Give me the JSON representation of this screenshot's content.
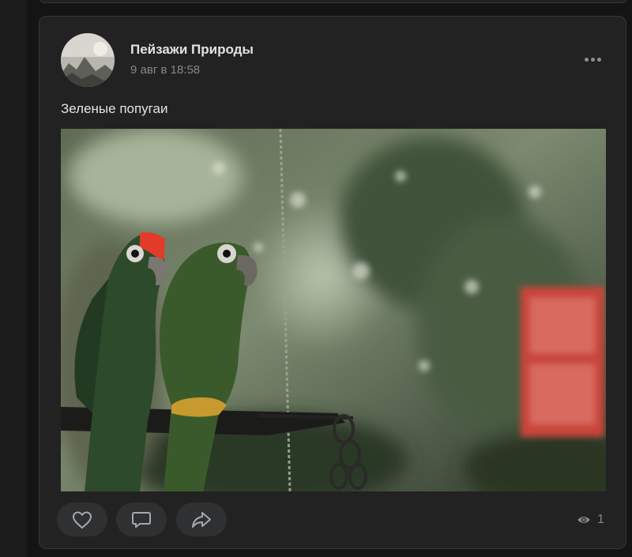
{
  "post": {
    "author": "Пейзажи Природы",
    "date": "9 авг в 18:58",
    "text": "Зеленые попугаи",
    "views": "1"
  },
  "actions": {
    "like_icon": "heart-icon",
    "comment_icon": "comment-icon",
    "share_icon": "share-icon",
    "more_icon": "more-dots-icon",
    "views_icon": "eye-icon"
  },
  "colors": {
    "page_background": "#141414",
    "card_background": "#222222",
    "button_background": "#2f3031",
    "primary_text": "#e1e3e6",
    "secondary_text": "#858789"
  }
}
